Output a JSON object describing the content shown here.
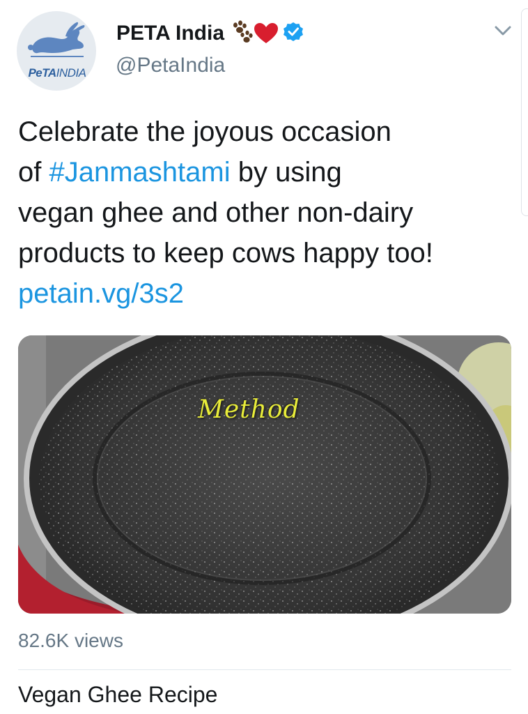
{
  "author": {
    "display_name": "PETA India",
    "handle": "@PetaIndia",
    "avatar_logo_text_bold": "PeTA",
    "avatar_logo_text_light": "INDIA",
    "badges": [
      "paw-prints-emoji",
      "red-heart-emoji",
      "verified-badge-icon"
    ]
  },
  "tweet": {
    "segments": [
      {
        "text": "Celebrate the joyous occasion"
      },
      {
        "prefix": "of ",
        "hashtag": "#Janmashtami",
        "suffix": " by using"
      },
      {
        "text": "vegan ghee and other non-dairy"
      },
      {
        "text": "products to keep cows happy too!"
      },
      {
        "link": "petain.vg/3s2"
      }
    ]
  },
  "media": {
    "overlay_caption": "Method",
    "views": "82.6K views",
    "title": "Vegan Ghee Recipe"
  },
  "colors": {
    "link": "#1b95e0",
    "text": "#14171a",
    "secondary_text": "#657786",
    "verified": "#1da1f2",
    "caption_yellow": "#e8ec3a"
  }
}
